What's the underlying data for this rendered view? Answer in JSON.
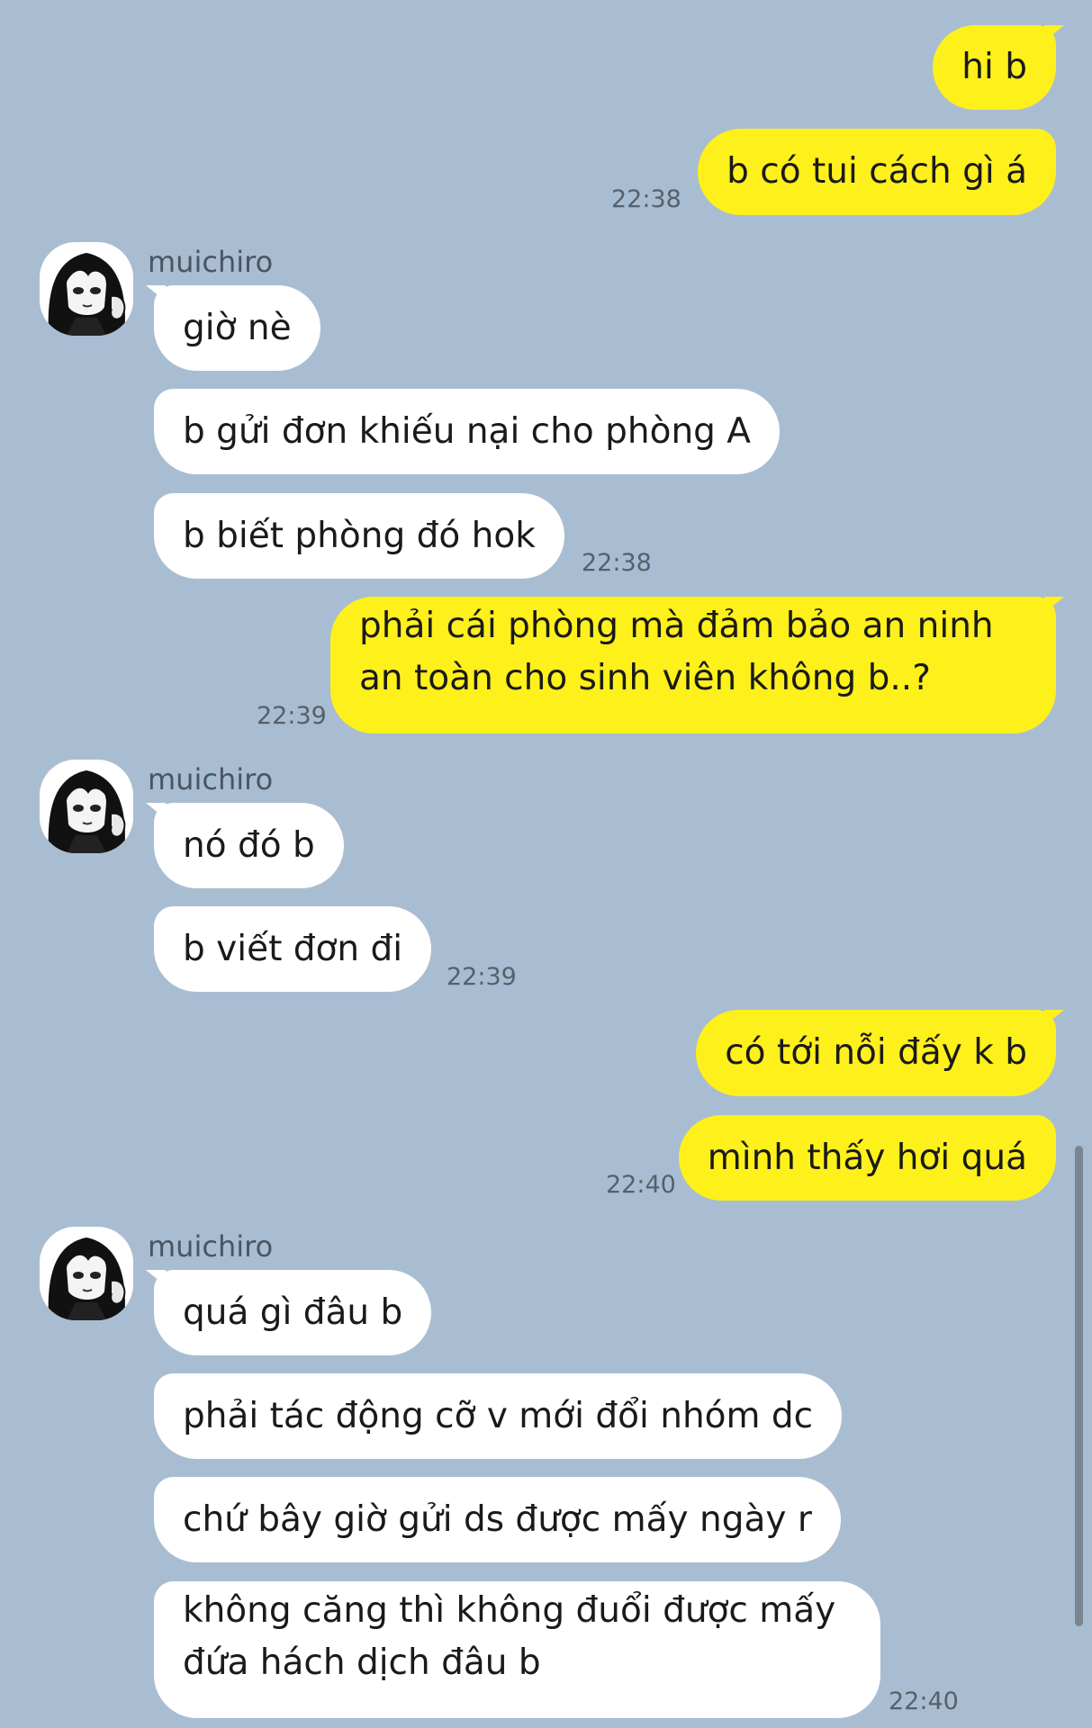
{
  "contact": {
    "name": "muichiro"
  },
  "colors": {
    "background": "#a9bdd2",
    "outgoing_bubble": "#fef01b",
    "incoming_bubble": "#ffffff"
  },
  "messages": [
    {
      "dir": "out",
      "text": "hi b"
    },
    {
      "dir": "out",
      "text": "b có tui cách gì á",
      "time": "22:38"
    },
    {
      "dir": "in",
      "sender": "muichiro",
      "text": "giờ nè"
    },
    {
      "dir": "in",
      "text": "b gửi đơn khiếu nại cho phòng A"
    },
    {
      "dir": "in",
      "text": "b biết phòng đó hok",
      "time": "22:38"
    },
    {
      "dir": "out",
      "text_lines": [
        "phải cái phòng mà đảm bảo an ninh",
        "an toàn cho sinh viên không b..?"
      ],
      "time": "22:39"
    },
    {
      "dir": "in",
      "sender": "muichiro",
      "text": "nó đó b"
    },
    {
      "dir": "in",
      "text": "b viết đơn đi",
      "time": "22:39"
    },
    {
      "dir": "out",
      "text": "có tới nỗi đấy k b"
    },
    {
      "dir": "out",
      "text": "mình thấy hơi quá",
      "time": "22:40"
    },
    {
      "dir": "in",
      "sender": "muichiro",
      "text": "quá gì đâu b"
    },
    {
      "dir": "in",
      "text": "phải tác động cỡ v mới đổi nhóm dc"
    },
    {
      "dir": "in",
      "text": "chứ bây giờ gửi ds được mấy ngày r"
    },
    {
      "dir": "in",
      "text_lines": [
        "không căng thì không đuổi được mấy",
        "đứa hách dịch đâu b"
      ],
      "time": "22:40"
    }
  ]
}
